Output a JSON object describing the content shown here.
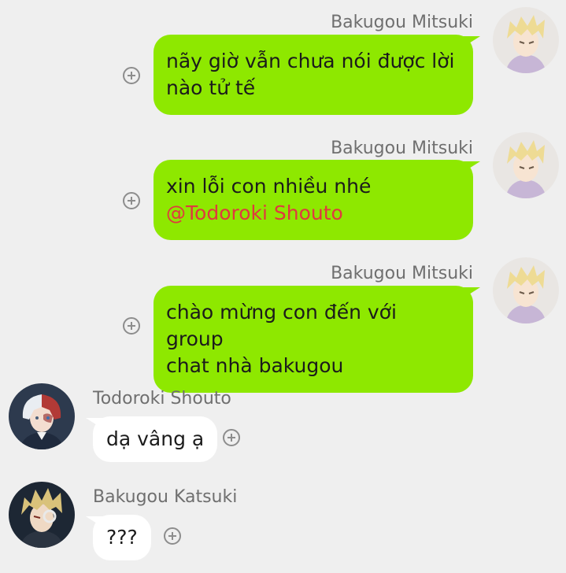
{
  "messages": [
    {
      "sender": "Bakugou Mitsuki",
      "lines": [
        "nãy giờ vẫn chưa nói được lời",
        "nào tử tế"
      ],
      "avatar_icon": "mitsuki-avatar"
    },
    {
      "sender": "Bakugou Mitsuki",
      "lines": [
        "xin lỗi con nhiều nhé"
      ],
      "mention": "@Todoroki Shouto",
      "avatar_icon": "mitsuki-avatar"
    },
    {
      "sender": "Bakugou Mitsuki",
      "lines": [
        "chào mừng con đến với group",
        "chat nhà bakugou"
      ],
      "avatar_icon": "mitsuki-avatar"
    },
    {
      "sender": "Todoroki Shouto",
      "lines": [
        "dạ vâng ạ"
      ],
      "avatar_icon": "todoroki-avatar"
    },
    {
      "sender": "Bakugou Katsuki",
      "lines": [
        "???"
      ],
      "avatar_icon": "katsuki-avatar"
    }
  ],
  "reaction_icon": "add-reaction-plus-icon",
  "colors": {
    "background": "#efefef",
    "outgoing_bubble": "#8ee800",
    "incoming_bubble": "#ffffff",
    "mention": "#e0393f",
    "sender_text": "#6f6f6f"
  }
}
